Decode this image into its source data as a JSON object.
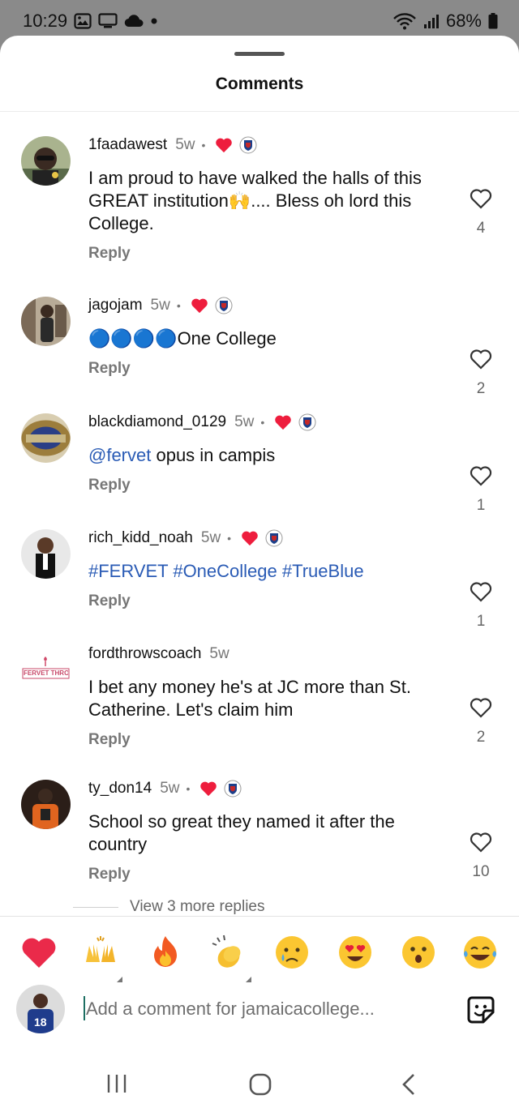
{
  "status_bar": {
    "time": "10:29",
    "battery": "68%",
    "left_icons": [
      "gallery-icon",
      "screen-icon",
      "cloud-icon"
    ],
    "right_icons": [
      "wifi-icon",
      "signal-icon",
      "battery-icon"
    ]
  },
  "sheet": {
    "title": "Comments"
  },
  "comments": [
    {
      "user": "1faadawest",
      "time": "5w",
      "text": "I am proud to have walked the halls of this GREAT institution🙌.... Bless oh lord this College.",
      "reply": "Reply",
      "likes": "4",
      "creator_liked": true,
      "avatar_color": "#5a6a4a"
    },
    {
      "user": "jagojam",
      "time": "5w",
      "text": "🔵🔵🔵🔵One College",
      "reply": "Reply",
      "likes": "2",
      "creator_liked": true,
      "avatar_color": "#6b5a48"
    },
    {
      "user": "blackdiamond_0129",
      "time": "5w",
      "mention": "@fervet",
      "text": " opus in campis",
      "reply": "Reply",
      "likes": "1",
      "creator_liked": true,
      "avatar_color": "#8a7a48"
    },
    {
      "user": "rich_kidd_noah",
      "time": "5w",
      "text": "#FERVET #OneCollege #TrueBlue",
      "reply": "Reply",
      "likes": "1",
      "creator_liked": true,
      "avatar_color": "#3b3b3b"
    },
    {
      "user": "fordthrowscoach",
      "time": "5w",
      "text": "I bet any money he's at JC more than St. Catherine. Let's claim him",
      "reply": "Reply",
      "likes": "2",
      "creator_liked": false,
      "avatar_color": "#ffffff"
    },
    {
      "user": "ty_don14",
      "time": "5w",
      "text": "School so great they named it after the country",
      "reply": "Reply",
      "likes": "10",
      "creator_liked": true,
      "avatar_color": "#c2531e"
    }
  ],
  "avatar_logo_text": "FERVET THROWS",
  "view_more": "View 3 more replies",
  "reaction_emojis": [
    "❤️",
    "🙌",
    "🔥",
    "👏",
    "😢",
    "😍",
    "😮",
    "😂"
  ],
  "comment_input": {
    "placeholder": "Add a comment for jamaicacollege..."
  },
  "my_avatar_jersey_number": "18",
  "nav": [
    "recent-apps-icon",
    "home-icon",
    "back-icon"
  ]
}
